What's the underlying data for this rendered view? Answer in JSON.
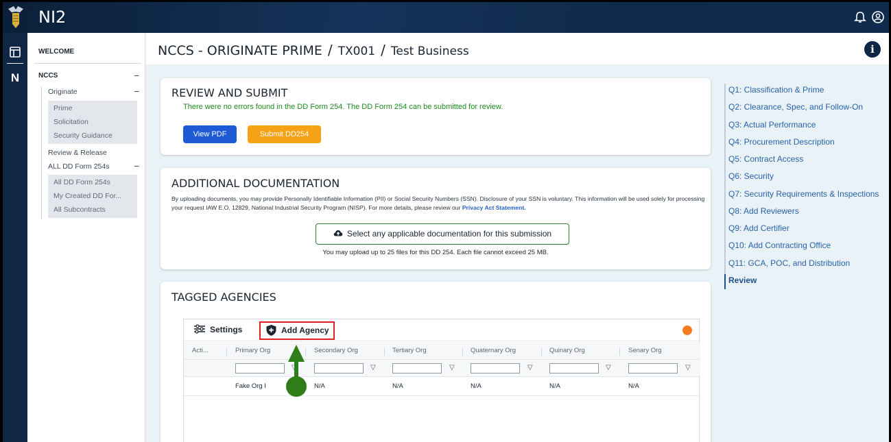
{
  "app": {
    "title": "NI2"
  },
  "rail": {
    "home_icon": "dashboard-icon",
    "letter": "N"
  },
  "sidebar": {
    "welcome": "WELCOME",
    "section": "NCCS",
    "originate": "Originate",
    "originate_items": [
      "Prime",
      "Solicitation",
      "Security Guidance"
    ],
    "review_release": "Review & Release",
    "all_forms": "ALL DD Form 254s",
    "form_items": [
      "All DD Form 254s",
      "My Created DD For...",
      "All Subcontracts"
    ],
    "collapse": "−"
  },
  "header": {
    "title": "NCCS - ORIGINATE PRIME",
    "crumb1": "TX001",
    "crumb2": "Test Business",
    "separator": "/"
  },
  "review": {
    "heading": "REVIEW AND SUBMIT",
    "message": "There were no errors found in the DD Form 254. The DD Form 254 can be submitted for review.",
    "view_pdf": "View PDF",
    "submit": "Submit DD254"
  },
  "docs": {
    "heading": "ADDITIONAL DOCUMENTATION",
    "text": "By uploading documents, you may provide Personally Identifiable Information (PII) or Social Security Numbers (SSN). Disclosure of your SSN is voluntary. This information will be used solely for processing your request IAW E.O. 12829, National Industrial Security Program (NISP). For more details, please review our",
    "link": "Privacy Act Statement.",
    "upload": "Select any applicable documentation for this submission",
    "note": "You may upload up to 25 files for this DD 254.  Each file cannot exceed 25 MB."
  },
  "agencies": {
    "heading": "TAGGED AGENCIES",
    "settings": "Settings",
    "add": "Add Agency",
    "columns": [
      "Acti...",
      "Primary Org",
      "Secondary Org",
      "Tertiary Org",
      "Quaternary Org",
      "Quinary Org",
      "Senary Org"
    ],
    "rows": [
      [
        "",
        "Fake Org I",
        "N/A",
        "N/A",
        "N/A",
        "N/A",
        "N/A"
      ]
    ]
  },
  "toc": {
    "items": [
      "Q1: Classification & Prime",
      "Q2: Clearance, Spec, and Follow-On",
      "Q3: Actual Performance",
      "Q4: Procurement Description",
      "Q5: Contract Access",
      "Q6: Security",
      "Q7: Security Requirements & Inspections",
      "Q8: Add Reviewers",
      "Q9: Add Certifier",
      "Q10: Add Contracting Office",
      "Q11: GCA, POC, and Distribution",
      "Review"
    ],
    "active": "Review"
  },
  "colors": {
    "navy": "#0f2744",
    "primary_btn": "#1f5ad6",
    "submit_btn": "#f5a216",
    "success": "#1e8a1e",
    "highlight": "#e02020",
    "annotation": "#2e7d1a"
  }
}
